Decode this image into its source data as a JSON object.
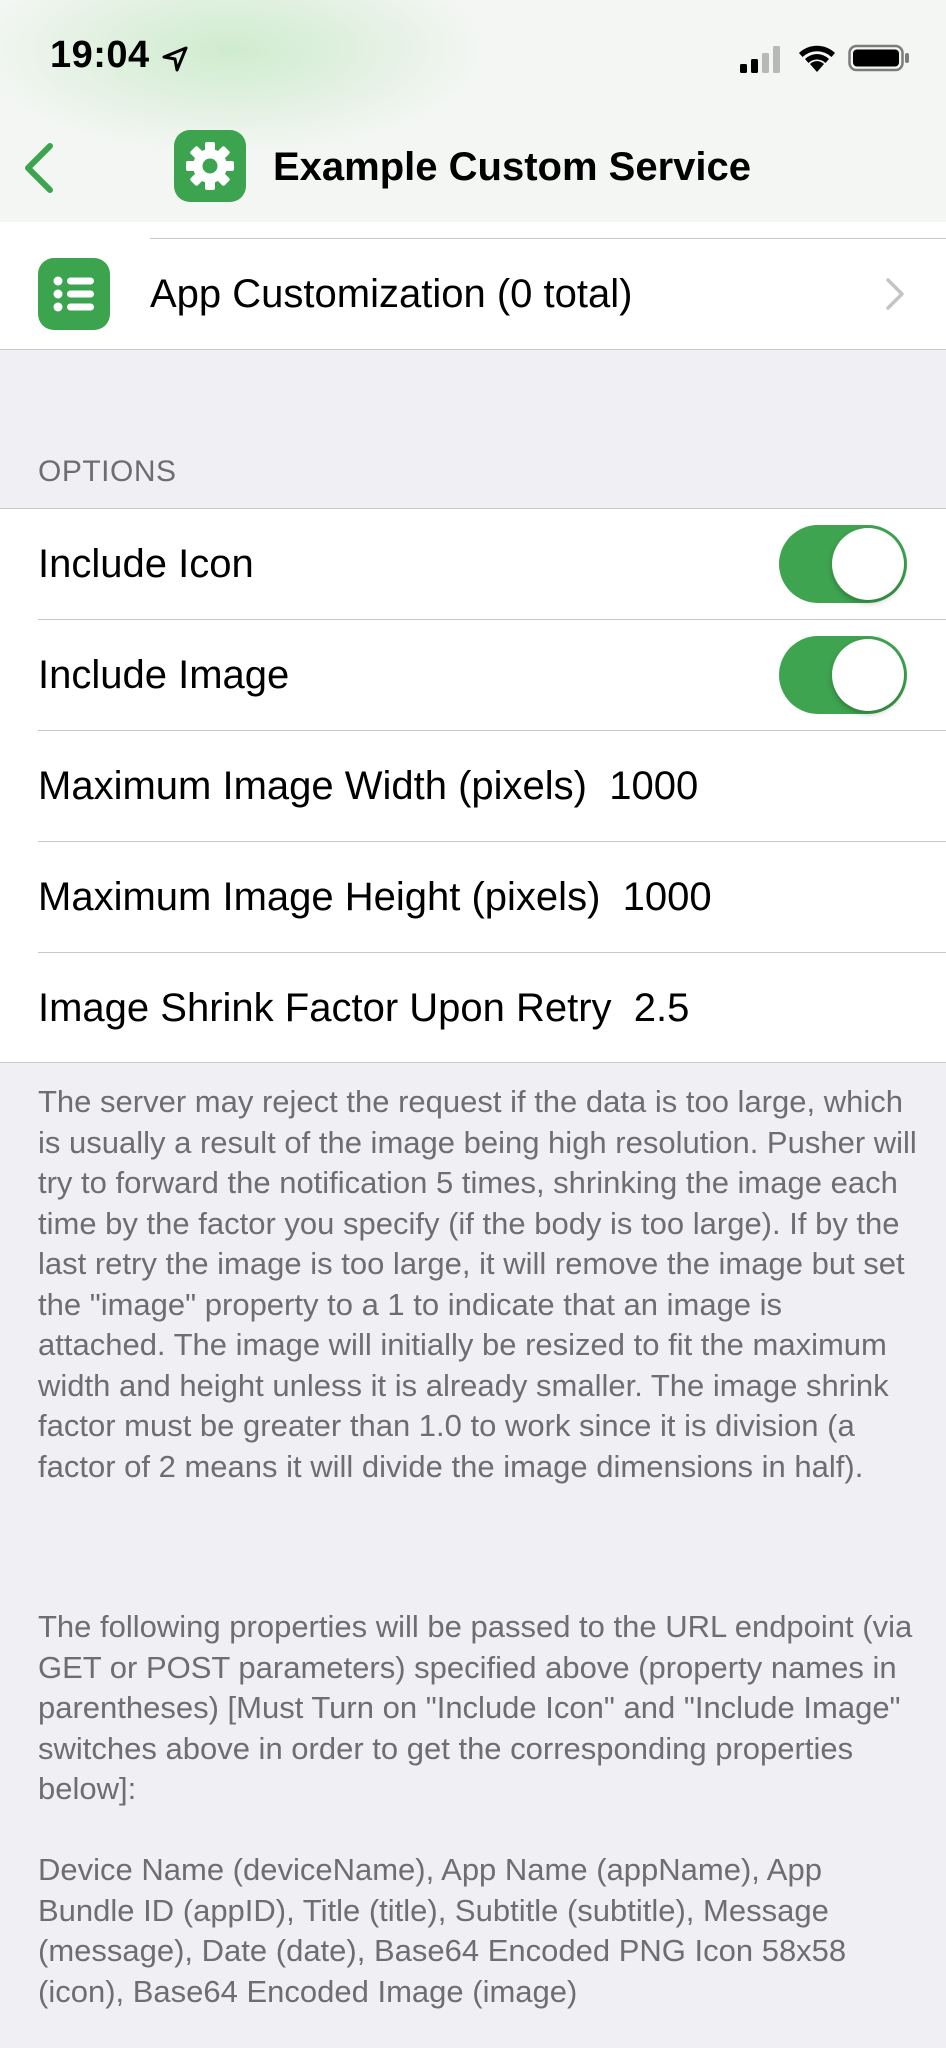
{
  "status_bar": {
    "time": "19:04"
  },
  "nav": {
    "title": "Example Custom Service",
    "app_icon": "gear-icon",
    "back_icon": "chevron-left-icon"
  },
  "app_customization": {
    "label": "App Customization (0 total)",
    "icon": "list-icon"
  },
  "options": {
    "header": "OPTIONS",
    "include_icon": {
      "label": "Include Icon",
      "enabled": true
    },
    "include_image": {
      "label": "Include Image",
      "enabled": true
    },
    "max_width": {
      "label": "Maximum Image Width (pixels)",
      "value": "1000"
    },
    "max_height": {
      "label": "Maximum Image Height (pixels)",
      "value": "1000"
    },
    "shrink_factor": {
      "label": "Image Shrink Factor Upon Retry",
      "value": "2.5"
    }
  },
  "footer": {
    "p1": "The server may reject the request if the data is too large, which is usually a result of the image being high resolution. Pusher will try to forward the notification 5 times, shrinking the image each time by the factor you specify (if the body is too large). If by the last retry the image is too large, it will remove the image but set the \"image\" property to a 1 to indicate that an image is attached. The image will initially be resized to fit the maximum width and height unless it is already smaller. The image shrink factor must be greater than 1.0 to work since it is division (a factor of 2 means it will divide the image dimensions in half).",
    "p2": "The following properties will be passed to the URL endpoint (via GET or POST parameters) specified above (property names in parentheses) [Must Turn on \"Include Icon\" and \"Include Image\" switches above in order to get the corresponding properties below]:",
    "p3": "Device Name (deviceName), App Name (appName), App Bundle ID (appID), Title (title), Subtitle (subtitle), Message (message), Date (date), Base64 Encoded PNG Icon 58x58 (icon), Base64 Encoded Image (image)"
  },
  "colors": {
    "accent": "#3ca34f",
    "toggle_on": "#3ea44f",
    "secondary_text": "#6d6d72",
    "separator": "#c8c8cc"
  }
}
